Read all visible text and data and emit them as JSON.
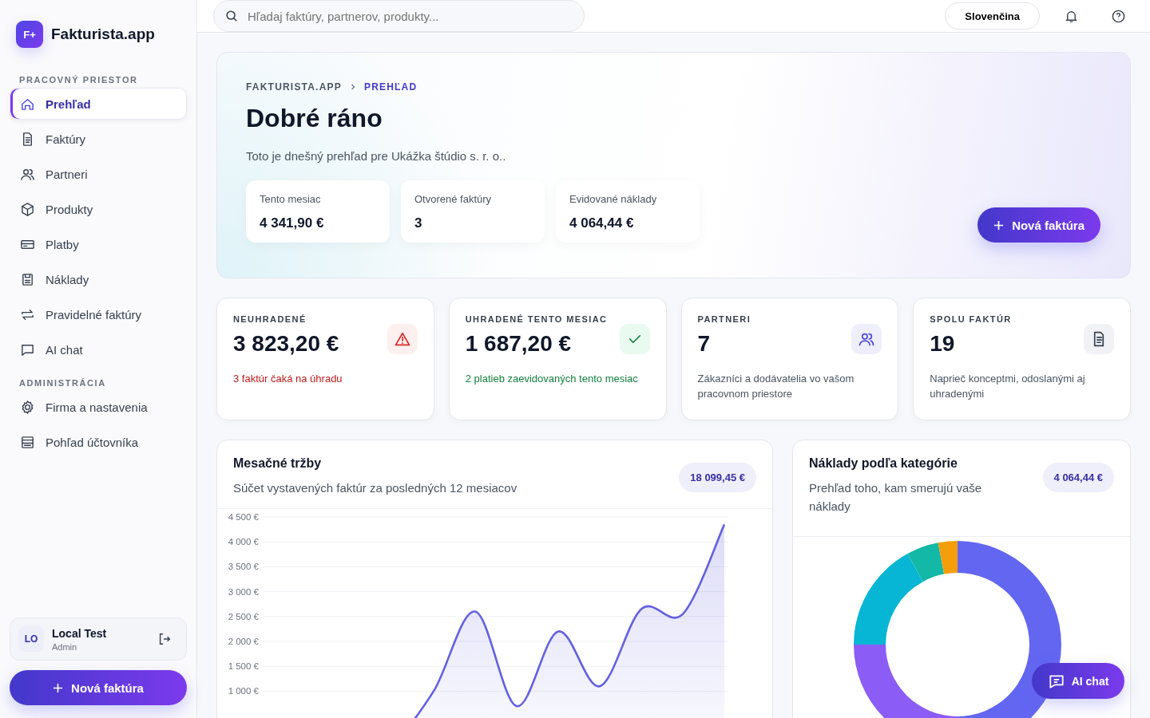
{
  "brand": {
    "logo": "F+",
    "name": "Fakturista.app"
  },
  "sidebar": {
    "sections": [
      {
        "title": "PRACOVNÝ PRIESTOR",
        "items": [
          {
            "label": "Prehľad",
            "selected": true
          },
          {
            "label": "Faktúry",
            "selected": false
          },
          {
            "label": "Partneri",
            "selected": false
          },
          {
            "label": "Produkty",
            "selected": false
          },
          {
            "label": "Platby",
            "selected": false
          },
          {
            "label": "Náklady",
            "selected": false
          },
          {
            "label": "Pravidelné faktúry",
            "selected": false
          },
          {
            "label": "AI chat",
            "selected": false
          }
        ]
      },
      {
        "title": "ADMINISTRÁCIA",
        "items": [
          {
            "label": "Firma a nastavenia",
            "selected": false
          },
          {
            "label": "Pohľad účtovníka",
            "selected": false
          }
        ]
      }
    ],
    "user": {
      "initials": "LO",
      "name": "Local Test",
      "role": "Admin"
    },
    "new_button": "Nová faktúra"
  },
  "topbar": {
    "search": {
      "placeholder": "Hľadaj faktúry, partnerov, produkty..."
    },
    "language": "Slovenčina"
  },
  "hero": {
    "breadcrumb": [
      "FAKTURISTA.APP",
      "PREHĽAD"
    ],
    "title": "Dobré ráno",
    "subtitle": "Toto je dnešný prehľad pre Ukážka štúdio s. r. o..",
    "stats": [
      {
        "label": "Tento mesiac",
        "value": "4 341,90 €"
      },
      {
        "label": "Otvorené faktúry",
        "value": "3"
      },
      {
        "label": "Evidované náklady",
        "value": "4 064,44 €"
      }
    ],
    "button": "Nová faktúra"
  },
  "kpis": [
    {
      "title": "NEUHRADENÉ",
      "value": "3 823,20 €",
      "note": "3 faktúr čaká na úhradu",
      "kind": "warning"
    },
    {
      "title": "UHRADENÉ TENTO MESIAC",
      "value": "1 687,20 €",
      "note": "2 platieb zaevidovaných tento mesiac",
      "kind": "success"
    },
    {
      "title": "PARTNERI",
      "value": "7",
      "note": "Zákazníci a dodávatelia vo vašom pracovnom priestore",
      "kind": "partners"
    },
    {
      "title": "SPOLU FAKTÚR",
      "value": "19",
      "note": "Naprieč konceptmi, odoslanými aj uhradenými",
      "kind": "invoices"
    }
  ],
  "revenue": {
    "title": "Mesačné tržby",
    "subtitle": "Súčet vystavených faktúr za posledných 12 mesiacov",
    "total": "18 099,45 €",
    "chart_data": {
      "type": "area",
      "grid": true,
      "ylim": [
        0,
        4500
      ],
      "yticks": [
        {
          "value": 1000,
          "label": "1 000 €"
        },
        {
          "value": 1500,
          "label": "1 500 €"
        },
        {
          "value": 2000,
          "label": "2 000 €"
        },
        {
          "value": 2500,
          "label": "2 500 €"
        },
        {
          "value": 3000,
          "label": "3 000 €"
        },
        {
          "value": 3500,
          "label": "3 500 €"
        },
        {
          "value": 4000,
          "label": "4 000 €"
        },
        {
          "value": 4500,
          "label": "4 500 €"
        }
      ],
      "series": [
        {
          "color": "#6360e0",
          "values": [
            0,
            0,
            0,
            0,
            1000,
            2600,
            700,
            2200,
            1100,
            2650,
            2550,
            4350
          ]
        }
      ]
    }
  },
  "costs": {
    "title": "Náklady podľa kategórie",
    "subtitle": "Prehľad toho, kam smerujú vaše náklady",
    "total": "4 064,44 €"
  },
  "ai_button": "AI chat"
}
